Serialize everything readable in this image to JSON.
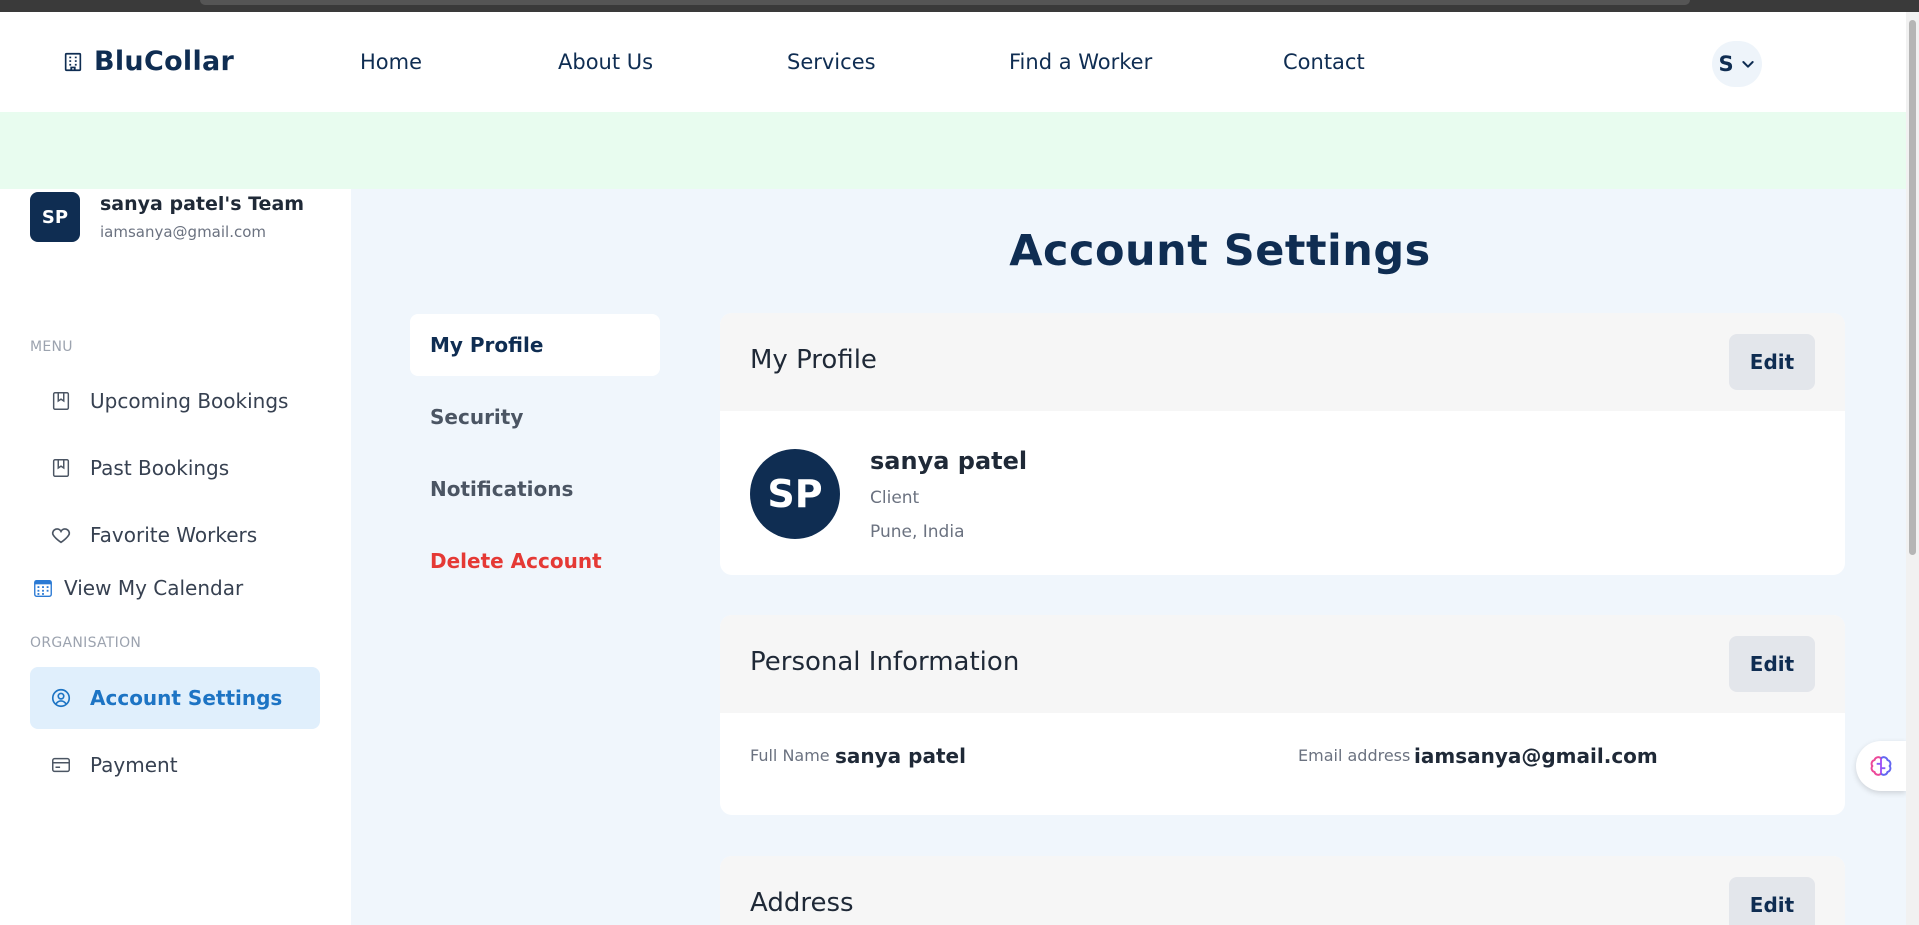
{
  "brand": {
    "name": "BluCollar"
  },
  "nav": {
    "links": [
      "Home",
      "About Us",
      "Services",
      "Find a Worker",
      "Contact"
    ],
    "user_initial": "S"
  },
  "sidebar": {
    "team_initials": "SP",
    "team_name": "sanya patel's Team",
    "team_email": "iamsanya@gmail.com",
    "menu_label": "MENU",
    "menu_items": [
      "Upcoming Bookings",
      "Past Bookings",
      "Favorite Workers",
      "View My Calendar"
    ],
    "org_label": "ORGANISATION",
    "org_items": [
      "Account Settings",
      "Payment"
    ]
  },
  "page": {
    "title": "Account Settings",
    "subnav": [
      "My Profile",
      "Security",
      "Notifications",
      "Delete Account"
    ]
  },
  "profile_card": {
    "title": "My Profile",
    "edit_label": "Edit",
    "initials": "SP",
    "name": "sanya patel",
    "role": "Client",
    "location": "Pune, India"
  },
  "personal_card": {
    "title": "Personal Information",
    "edit_label": "Edit",
    "full_name_label": "Full Name",
    "full_name": "sanya patel",
    "email_label": "Email address",
    "email": "iamsanya@gmail.com"
  },
  "address_card": {
    "title": "Address",
    "edit_label": "Edit"
  },
  "colors": {
    "brand_navy": "#0f2d52",
    "accent_blue": "#1d74c4",
    "danger_red": "#e53935",
    "banner_green": "#e8fcef"
  },
  "icons": {
    "logo": "building-icon",
    "user_menu": "chevron-down-icon",
    "upcoming": "bookmark-icon",
    "past": "bookmark-icon",
    "favorites": "heart-icon",
    "calendar": "calendar-icon",
    "account": "user-circle-icon",
    "payment": "credit-card-icon",
    "assistant": "brain-icon"
  }
}
